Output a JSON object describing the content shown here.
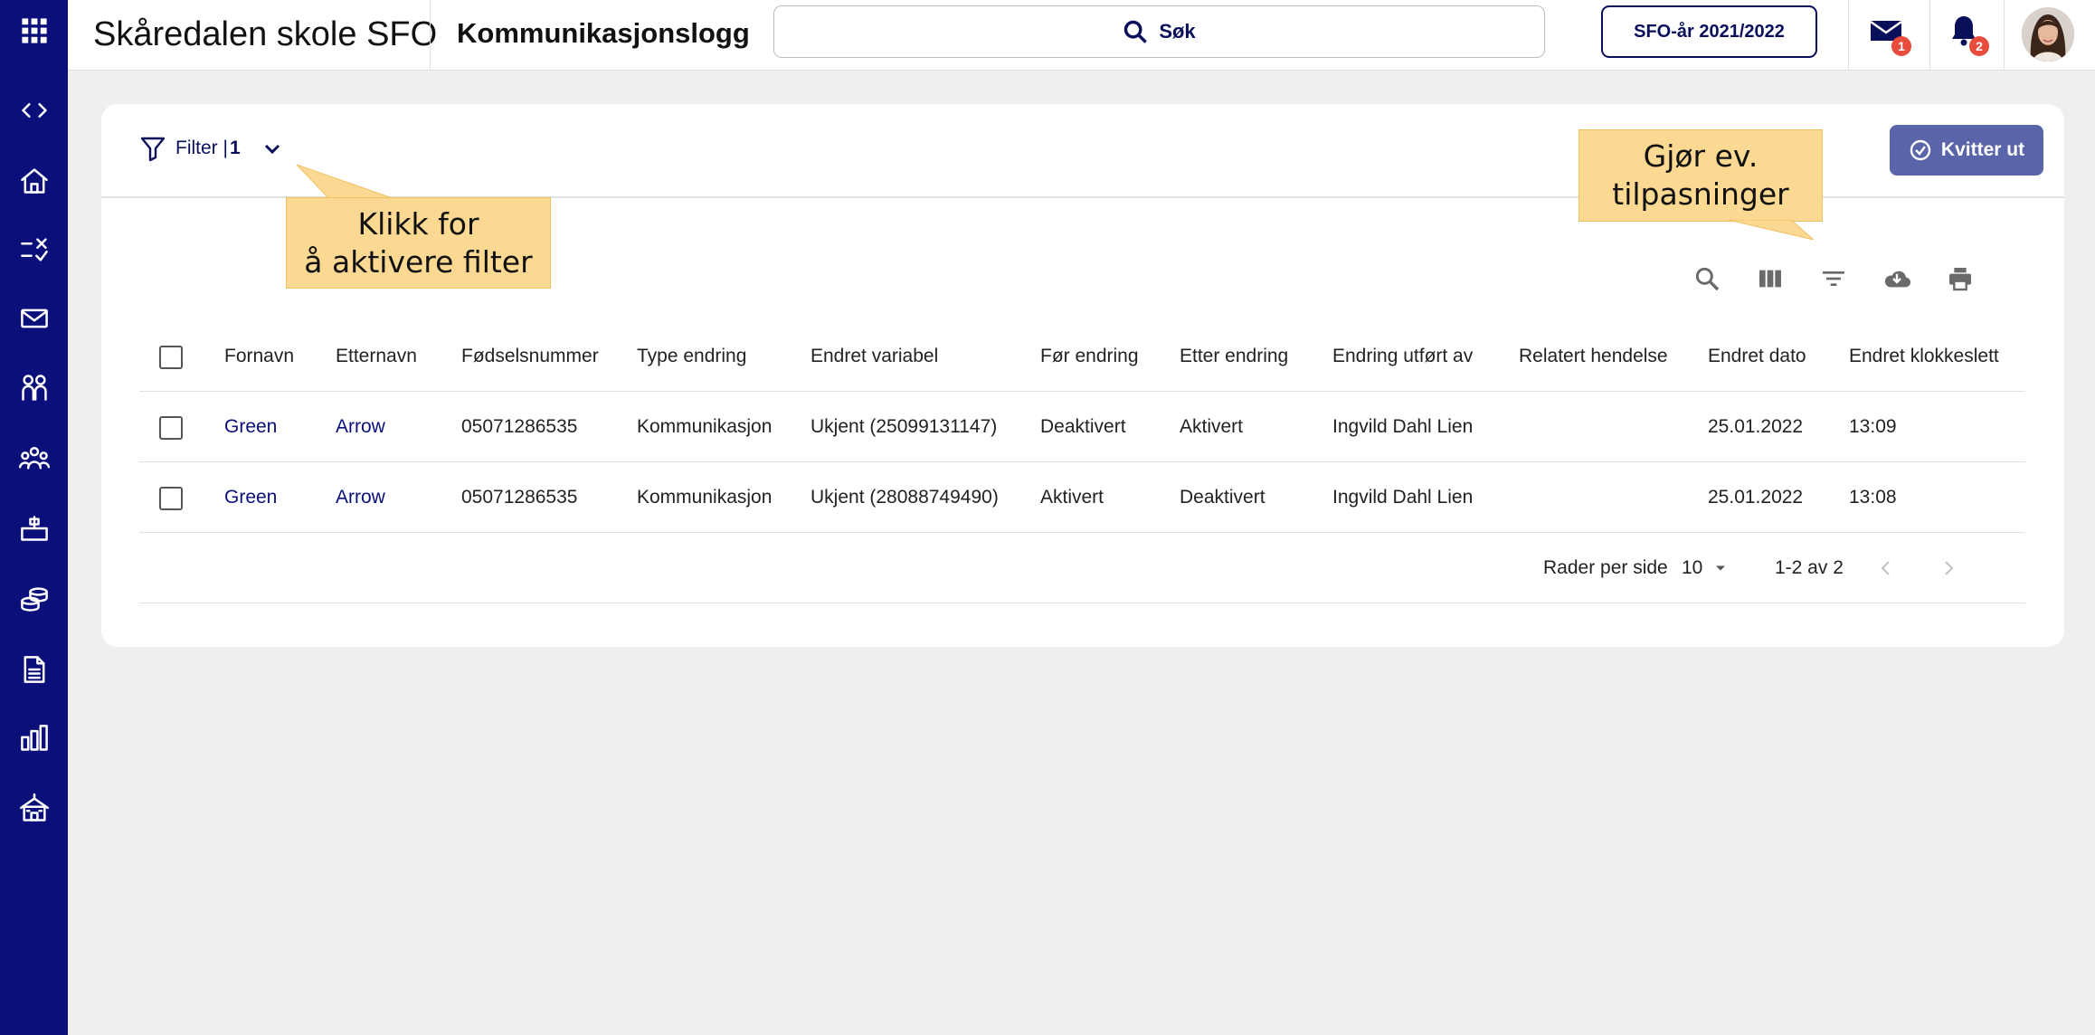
{
  "header": {
    "school_name": "Skåredalen skole SFO",
    "page_title": "Kommunikasjonslogg",
    "search_label": "Søk",
    "year_button": "SFO-år 2021/2022",
    "mail_badge": "1",
    "notification_badge": "2"
  },
  "sidebar": {
    "icons": [
      "apps-grid-icon",
      "code-toggle-icon",
      "home-icon",
      "checklist-icon",
      "mail-icon",
      "people-icon",
      "group-icon",
      "desk-icon",
      "coins-icon",
      "document-icon",
      "bar-chart-icon",
      "school-icon"
    ]
  },
  "filter": {
    "label": "Filter |",
    "count": "1"
  },
  "actions": {
    "kvitter_ut": "Kvitter ut"
  },
  "toolbar_icons": [
    "search-icon",
    "columns-icon",
    "filter-list-icon",
    "cloud-download-icon",
    "print-icon"
  ],
  "table": {
    "columns": [
      "Fornavn",
      "Etternavn",
      "Fødselsnummer",
      "Type endring",
      "Endret variabel",
      "Før endring",
      "Etter endring",
      "Endring utført av",
      "Relatert hendelse",
      "Endret dato",
      "Endret klokkeslett"
    ],
    "rows": [
      [
        "Green",
        "Arrow",
        "05071286535",
        "Kommunikasjon",
        "Ukjent (25099131147)",
        "Deaktivert",
        "Aktivert",
        "Ingvild Dahl Lien",
        "",
        "25.01.2022",
        "13:09"
      ],
      [
        "Green",
        "Arrow",
        "05071286535",
        "Kommunikasjon",
        "Ukjent (28088749490)",
        "Aktivert",
        "Deaktivert",
        "Ingvild Dahl Lien",
        "",
        "25.01.2022",
        "13:08"
      ]
    ]
  },
  "pagination": {
    "rows_per_page_label": "Rader per side",
    "rows_per_page_value": "10",
    "range": "1-2 av 2"
  },
  "callouts": {
    "filter_hint": "Klikk for\nå aktivere filter",
    "adjust_hint": "Gjør ev.\ntilpasninger"
  },
  "colors": {
    "sidebar": "#0a0f7a",
    "accent_button": "#5a64a8",
    "callout": "#fcd992",
    "badge": "#e74c3c"
  }
}
